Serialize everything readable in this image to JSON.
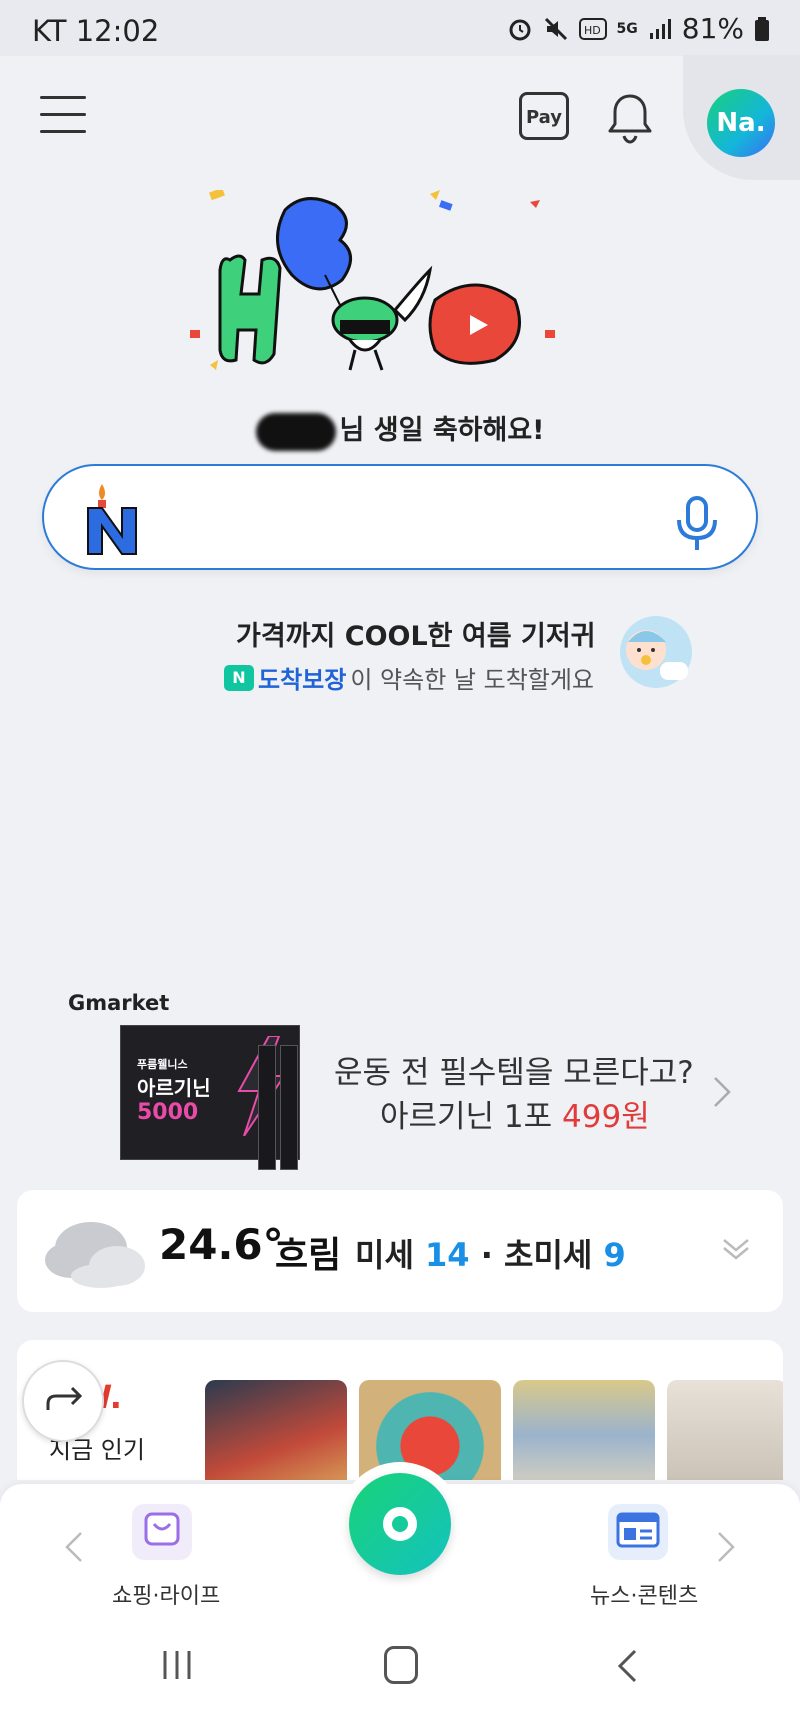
{
  "status_bar": {
    "carrier": "KT",
    "time": "12:02",
    "network": "5G",
    "battery": "81%"
  },
  "header": {
    "pay_label": "Pay",
    "profile_initials": "Na."
  },
  "birthday": {
    "message": "님 생일 축하해요!"
  },
  "promo": {
    "title": "가격까지 COOL한 여름 기저귀",
    "badge": "N",
    "brand": "도착보장",
    "subtitle": "이 약속한 날 도착할게요"
  },
  "ad": {
    "advertiser": "Gmarket",
    "product_top": "푸름웰니스",
    "product_name": "아르기닌",
    "product_amount": "5000",
    "line1": "운동 전 필수템을 모른다고?",
    "line2_prefix": "아르기닌 1포 ",
    "price": "499원"
  },
  "weather": {
    "temperature": "24.6°",
    "condition": "흐림",
    "fine_dust_label": "미세",
    "fine_dust_value": "14",
    "separator": " · ",
    "ultra_fine_dust_label": "초미세",
    "ultra_fine_dust_value": "9"
  },
  "now_section": {
    "logo": "W.",
    "label": "지금 인기"
  },
  "bottom_nav": {
    "left_label": "쇼핑·라이프",
    "right_label": "뉴스·콘텐츠"
  },
  "colors": {
    "accent_blue": "#2d7bd9",
    "green": "#18d377",
    "price_red": "#e03c3c"
  }
}
